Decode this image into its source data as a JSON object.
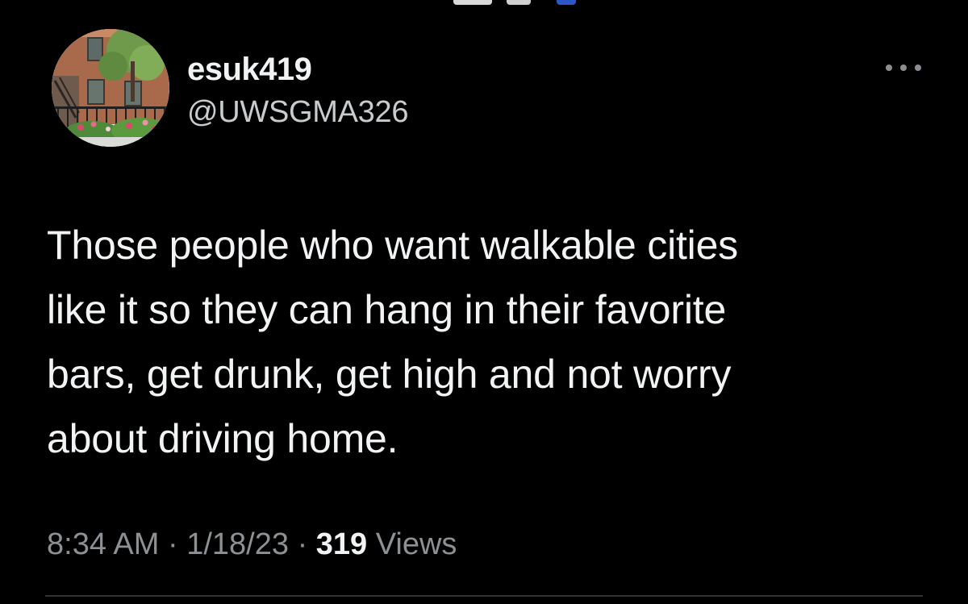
{
  "theme": {
    "background": "#000000",
    "primary_text": "#e7e9ea",
    "secondary_text": "#8d9194"
  },
  "tweet": {
    "display_name": "esuk419",
    "handle": "@UWSGMA326",
    "text_lines": [
      "Those people who want walkable cities",
      "like it so they can hang in their favorite",
      "bars, get drunk, get high and not worry",
      "about driving home."
    ],
    "time": "8:34 AM",
    "date": "1/18/23",
    "separator": "·",
    "views_count": "319",
    "views_label": "Views",
    "more_icon": "more-horizontal-icon",
    "avatar": "profile-photo-brownstone-with-garden"
  }
}
